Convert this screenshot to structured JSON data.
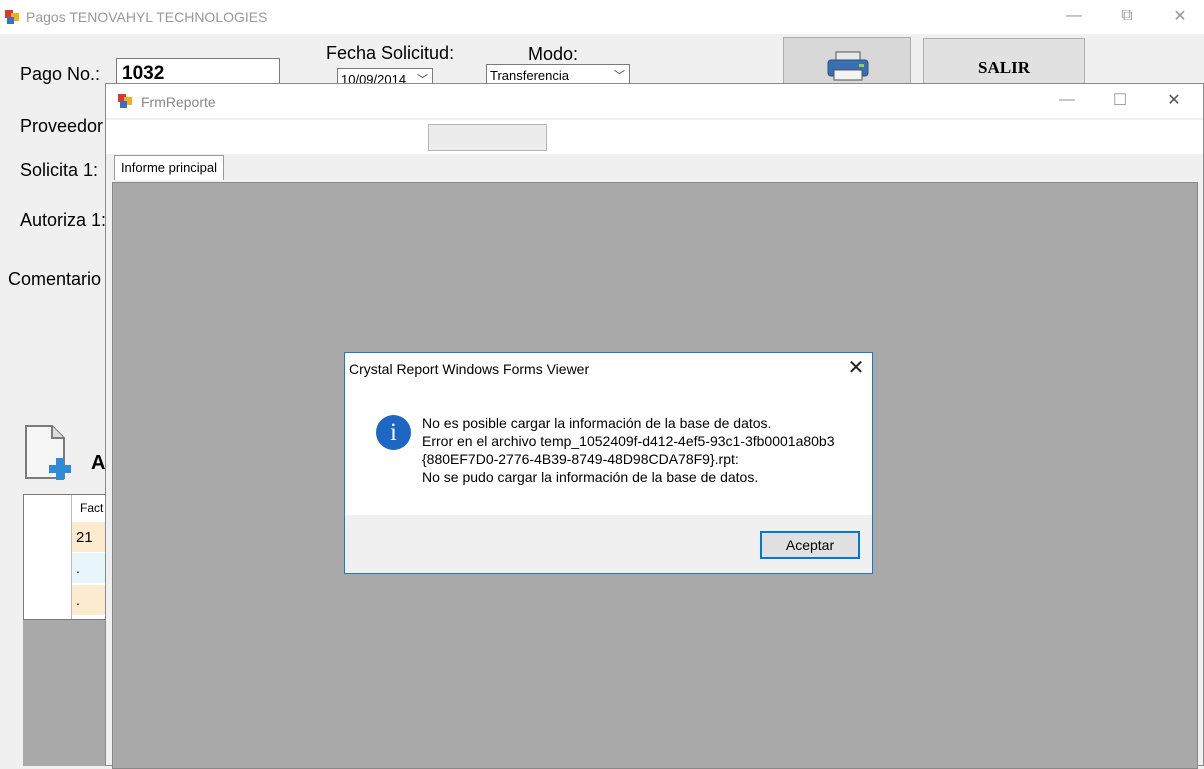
{
  "main_window": {
    "title": "Pagos TENOVAHYL TECHNOLOGIES",
    "caption_minimize": "—",
    "caption_restore": "⧉",
    "caption_close": "✕"
  },
  "form": {
    "pago_label": "Pago No.:",
    "pago_value": "1032",
    "fecha_label": "Fecha Solicitud:",
    "fecha_value": "10/09/2014",
    "modo_label": "Modo:",
    "modo_value": "Transferencia",
    "proveedor_label": "Proveedor",
    "solicita_label": "Solicita 1:",
    "autoriza_label": "Autoriza 1:",
    "comentario_label": "Comentario",
    "add_label": "A",
    "salir_label": "SALIR"
  },
  "grid": {
    "header": "Fact",
    "rows": [
      "21",
      ".",
      "."
    ]
  },
  "report_window": {
    "title": "FrmReporte",
    "tab_label": "Informe principal",
    "caption_minimize": "—",
    "caption_maximize": "☐",
    "caption_close": "✕"
  },
  "dialog": {
    "title": "Crystal Report Windows Forms Viewer",
    "close": "✕",
    "icon_glyph": "i",
    "lines": [
      "No es posible cargar la información de la base de datos.",
      "Error en el archivo temp_1052409f-d412-4ef5-93c1-3fb0001a80b3",
      "{880EF7D0-2776-4B39-8749-48D98CDA78F9}.rpt:",
      "No se pudo cargar la información de la base de datos."
    ],
    "ok_label": "Aceptar"
  },
  "colors": {
    "accent": "#0078d7",
    "info_icon": "#1c66c4",
    "report_bg": "#a9a9a9"
  }
}
